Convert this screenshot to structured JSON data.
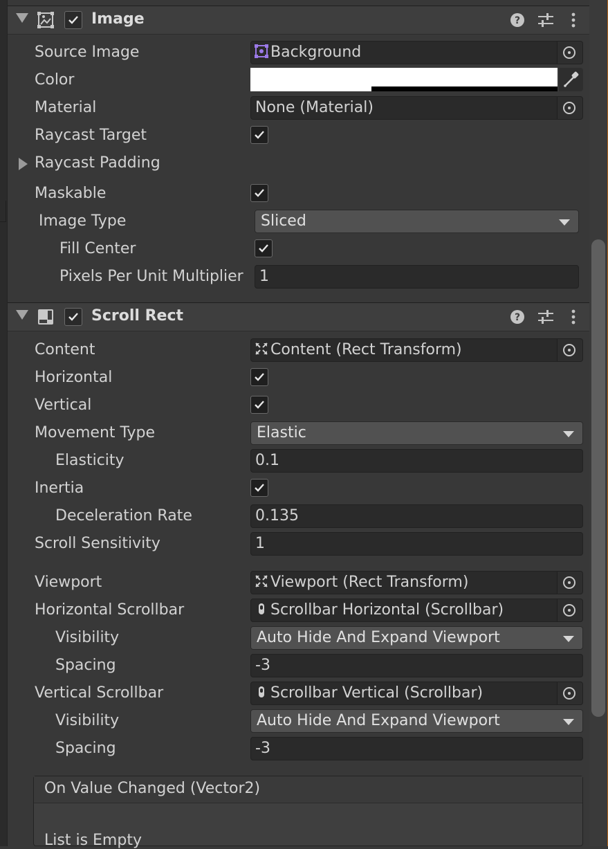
{
  "image_component": {
    "title": "Image",
    "enabled": true,
    "fields": {
      "source_image_label": "Source Image",
      "source_image_value": "Background",
      "color_label": "Color",
      "material_label": "Material",
      "material_value": "None (Material)",
      "raycast_target_label": "Raycast Target",
      "raycast_target_checked": true,
      "raycast_padding_label": "Raycast Padding",
      "maskable_label": "Maskable",
      "maskable_checked": true,
      "image_type_label": "Image Type",
      "image_type_value": "Sliced",
      "fill_center_label": "Fill Center",
      "fill_center_checked": true,
      "ppu_label": "Pixels Per Unit Multiplier",
      "ppu_value": "1"
    }
  },
  "scroll_rect_component": {
    "title": "Scroll Rect",
    "enabled": true,
    "fields": {
      "content_label": "Content",
      "content_value": "Content (Rect Transform)",
      "horizontal_label": "Horizontal",
      "horizontal_checked": true,
      "vertical_label": "Vertical",
      "vertical_checked": true,
      "movement_type_label": "Movement Type",
      "movement_type_value": "Elastic",
      "elasticity_label": "Elasticity",
      "elasticity_value": "0.1",
      "inertia_label": "Inertia",
      "inertia_checked": true,
      "deceleration_label": "Deceleration Rate",
      "deceleration_value": "0.135",
      "scroll_sensitivity_label": "Scroll Sensitivity",
      "scroll_sensitivity_value": "1",
      "viewport_label": "Viewport",
      "viewport_value": "Viewport (Rect Transform)",
      "h_scrollbar_label": "Horizontal Scrollbar",
      "h_scrollbar_value": "Scrollbar Horizontal (Scrollbar)",
      "h_visibility_label": "Visibility",
      "h_visibility_value": "Auto Hide And Expand Viewport",
      "h_spacing_label": "Spacing",
      "h_spacing_value": "-3",
      "v_scrollbar_label": "Vertical Scrollbar",
      "v_scrollbar_value": "Scrollbar Vertical (Scrollbar)",
      "v_visibility_label": "Visibility",
      "v_visibility_value": "Auto Hide And Expand Viewport",
      "v_spacing_label": "Spacing",
      "v_spacing_value": "-3"
    },
    "event": {
      "title": "On Value Changed (Vector2)",
      "empty_text": "List is Empty"
    }
  },
  "icons": {
    "help": "help-icon",
    "presets": "sliders-icon",
    "more": "kebab-menu-icon",
    "object_picker": "target-icon",
    "eyedropper": "eyedropper-icon"
  },
  "colors": {
    "panel_bg": "#383838",
    "field_bg": "#2a2a2a",
    "header_bg": "#3e3e3e",
    "sprite_icon_accent": "#9b79e8",
    "color_swatch": "#ffffff"
  }
}
